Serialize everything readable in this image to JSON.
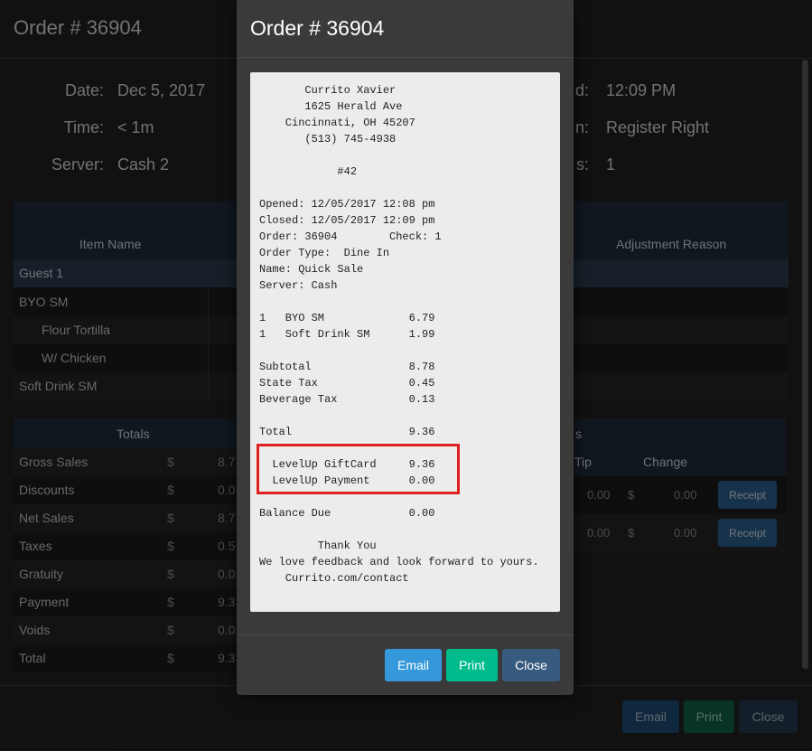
{
  "background": {
    "title": "Order # 36904",
    "meta_left": [
      {
        "label": "Date:",
        "value": "Dec 5, 2017"
      },
      {
        "label": "Time:",
        "value": "< 1m"
      },
      {
        "label": "Server:",
        "value": "Cash 2"
      }
    ],
    "meta_right": [
      {
        "label": "d:",
        "value": "12:09 PM"
      },
      {
        "label": "n:",
        "value": "Register Right"
      },
      {
        "label": "s:",
        "value": "1"
      }
    ],
    "items_table": {
      "col_item": "Item Name",
      "col_adjust": "Adjustment Reason",
      "guest": "Guest 1",
      "rows": [
        "BYO SM",
        "Flour Tortilla",
        "W/ Chicken",
        "Soft Drink SM"
      ]
    },
    "totals": {
      "header": "Totals",
      "rows": [
        {
          "label": "Gross Sales",
          "sym": "$",
          "value": "8.7"
        },
        {
          "label": "Discounts",
          "sym": "$",
          "value": "0.0"
        },
        {
          "label": "Net Sales",
          "sym": "$",
          "value": "8.7"
        },
        {
          "label": "Taxes",
          "sym": "$",
          "value": "0.5"
        },
        {
          "label": "Gratuity",
          "sym": "$",
          "value": "0.0"
        },
        {
          "label": "Payment",
          "sym": "$",
          "value": "9.3"
        },
        {
          "label": "Voids",
          "sym": "$",
          "value": "0.0"
        },
        {
          "label": "Total",
          "sym": "$",
          "value": "9.3"
        }
      ]
    },
    "payments": {
      "header": "s",
      "col_tip": "Tip",
      "col_change": "Change",
      "rows": [
        {
          "tip": "0.00",
          "sym": "$",
          "change": "0.00",
          "button": "Receipt"
        },
        {
          "tip": "0.00",
          "sym": "$",
          "change": "0.00",
          "button": "Receipt"
        }
      ]
    },
    "footer_buttons": {
      "email": "Email",
      "print": "Print",
      "close": "Close"
    }
  },
  "modal": {
    "title": "Order # 36904",
    "receipt_lines": [
      "       Currito Xavier",
      "       1625 Herald Ave",
      "    Cincinnati, OH 45207",
      "       (513) 745-4938",
      "",
      "            #42",
      "",
      "Opened: 12/05/2017 12:08 pm",
      "Closed: 12/05/2017 12:09 pm",
      "Order: 36904        Check: 1",
      "Order Type:  Dine In",
      "Name: Quick Sale",
      "Server: Cash",
      "",
      "1   BYO SM             6.79",
      "1   Soft Drink SM      1.99",
      "",
      "Subtotal               8.78",
      "State Tax              0.45",
      "Beverage Tax           0.13",
      "",
      "Total                  9.36",
      "",
      "  LevelUp GiftCard     9.36",
      "  LevelUp Payment      0.00",
      "",
      "Balance Due            0.00",
      "",
      "         Thank You",
      "We love feedback and look forward to yours.",
      "    Currito.com/contact"
    ],
    "buttons": {
      "email": "Email",
      "print": "Print",
      "close": "Close"
    },
    "colors": {
      "email": "#3498db",
      "print": "#00bc8c",
      "close": "#375a7f",
      "highlight": "#e02020"
    }
  }
}
